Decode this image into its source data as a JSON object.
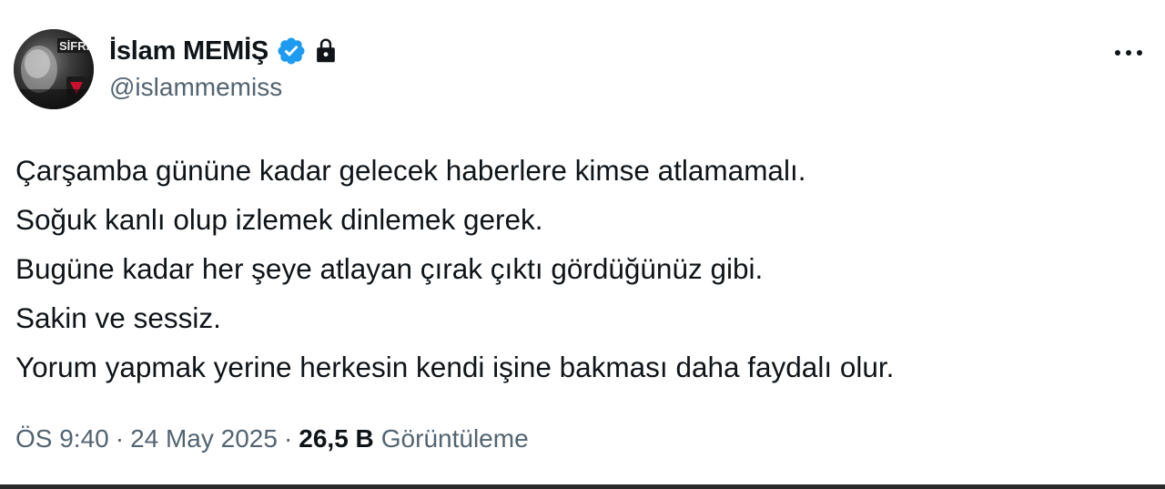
{
  "colors": {
    "primary_text": "#0f1419",
    "secondary_text": "#536471",
    "verified_blue": "#1d9bf0",
    "background": "#ffffff"
  },
  "author": {
    "display_name": "İslam MEMİŞ",
    "handle": "@islammemiss",
    "avatar_icon": "profile-photo",
    "badges": [
      "verified-badge-icon",
      "lock-icon"
    ]
  },
  "menu": {
    "icon": "more-options-icon"
  },
  "tweet": {
    "lines": [
      "Çarşamba gününe kadar gelecek haberlere kimse atlamamalı.",
      "Soğuk kanlı olup izlemek dinlemek gerek.",
      "Bugüne kadar her şeye atlayan çırak çıktı gördüğünüz gibi.",
      "Sakin ve sessiz.",
      "Yorum yapmak yerine herkesin kendi işine bakması daha faydalı olur."
    ]
  },
  "meta": {
    "time": "ÖS 9:40",
    "separator": "·",
    "date": "24 May 2025",
    "views_count": "26,5 B",
    "views_label": "Görüntüleme"
  }
}
